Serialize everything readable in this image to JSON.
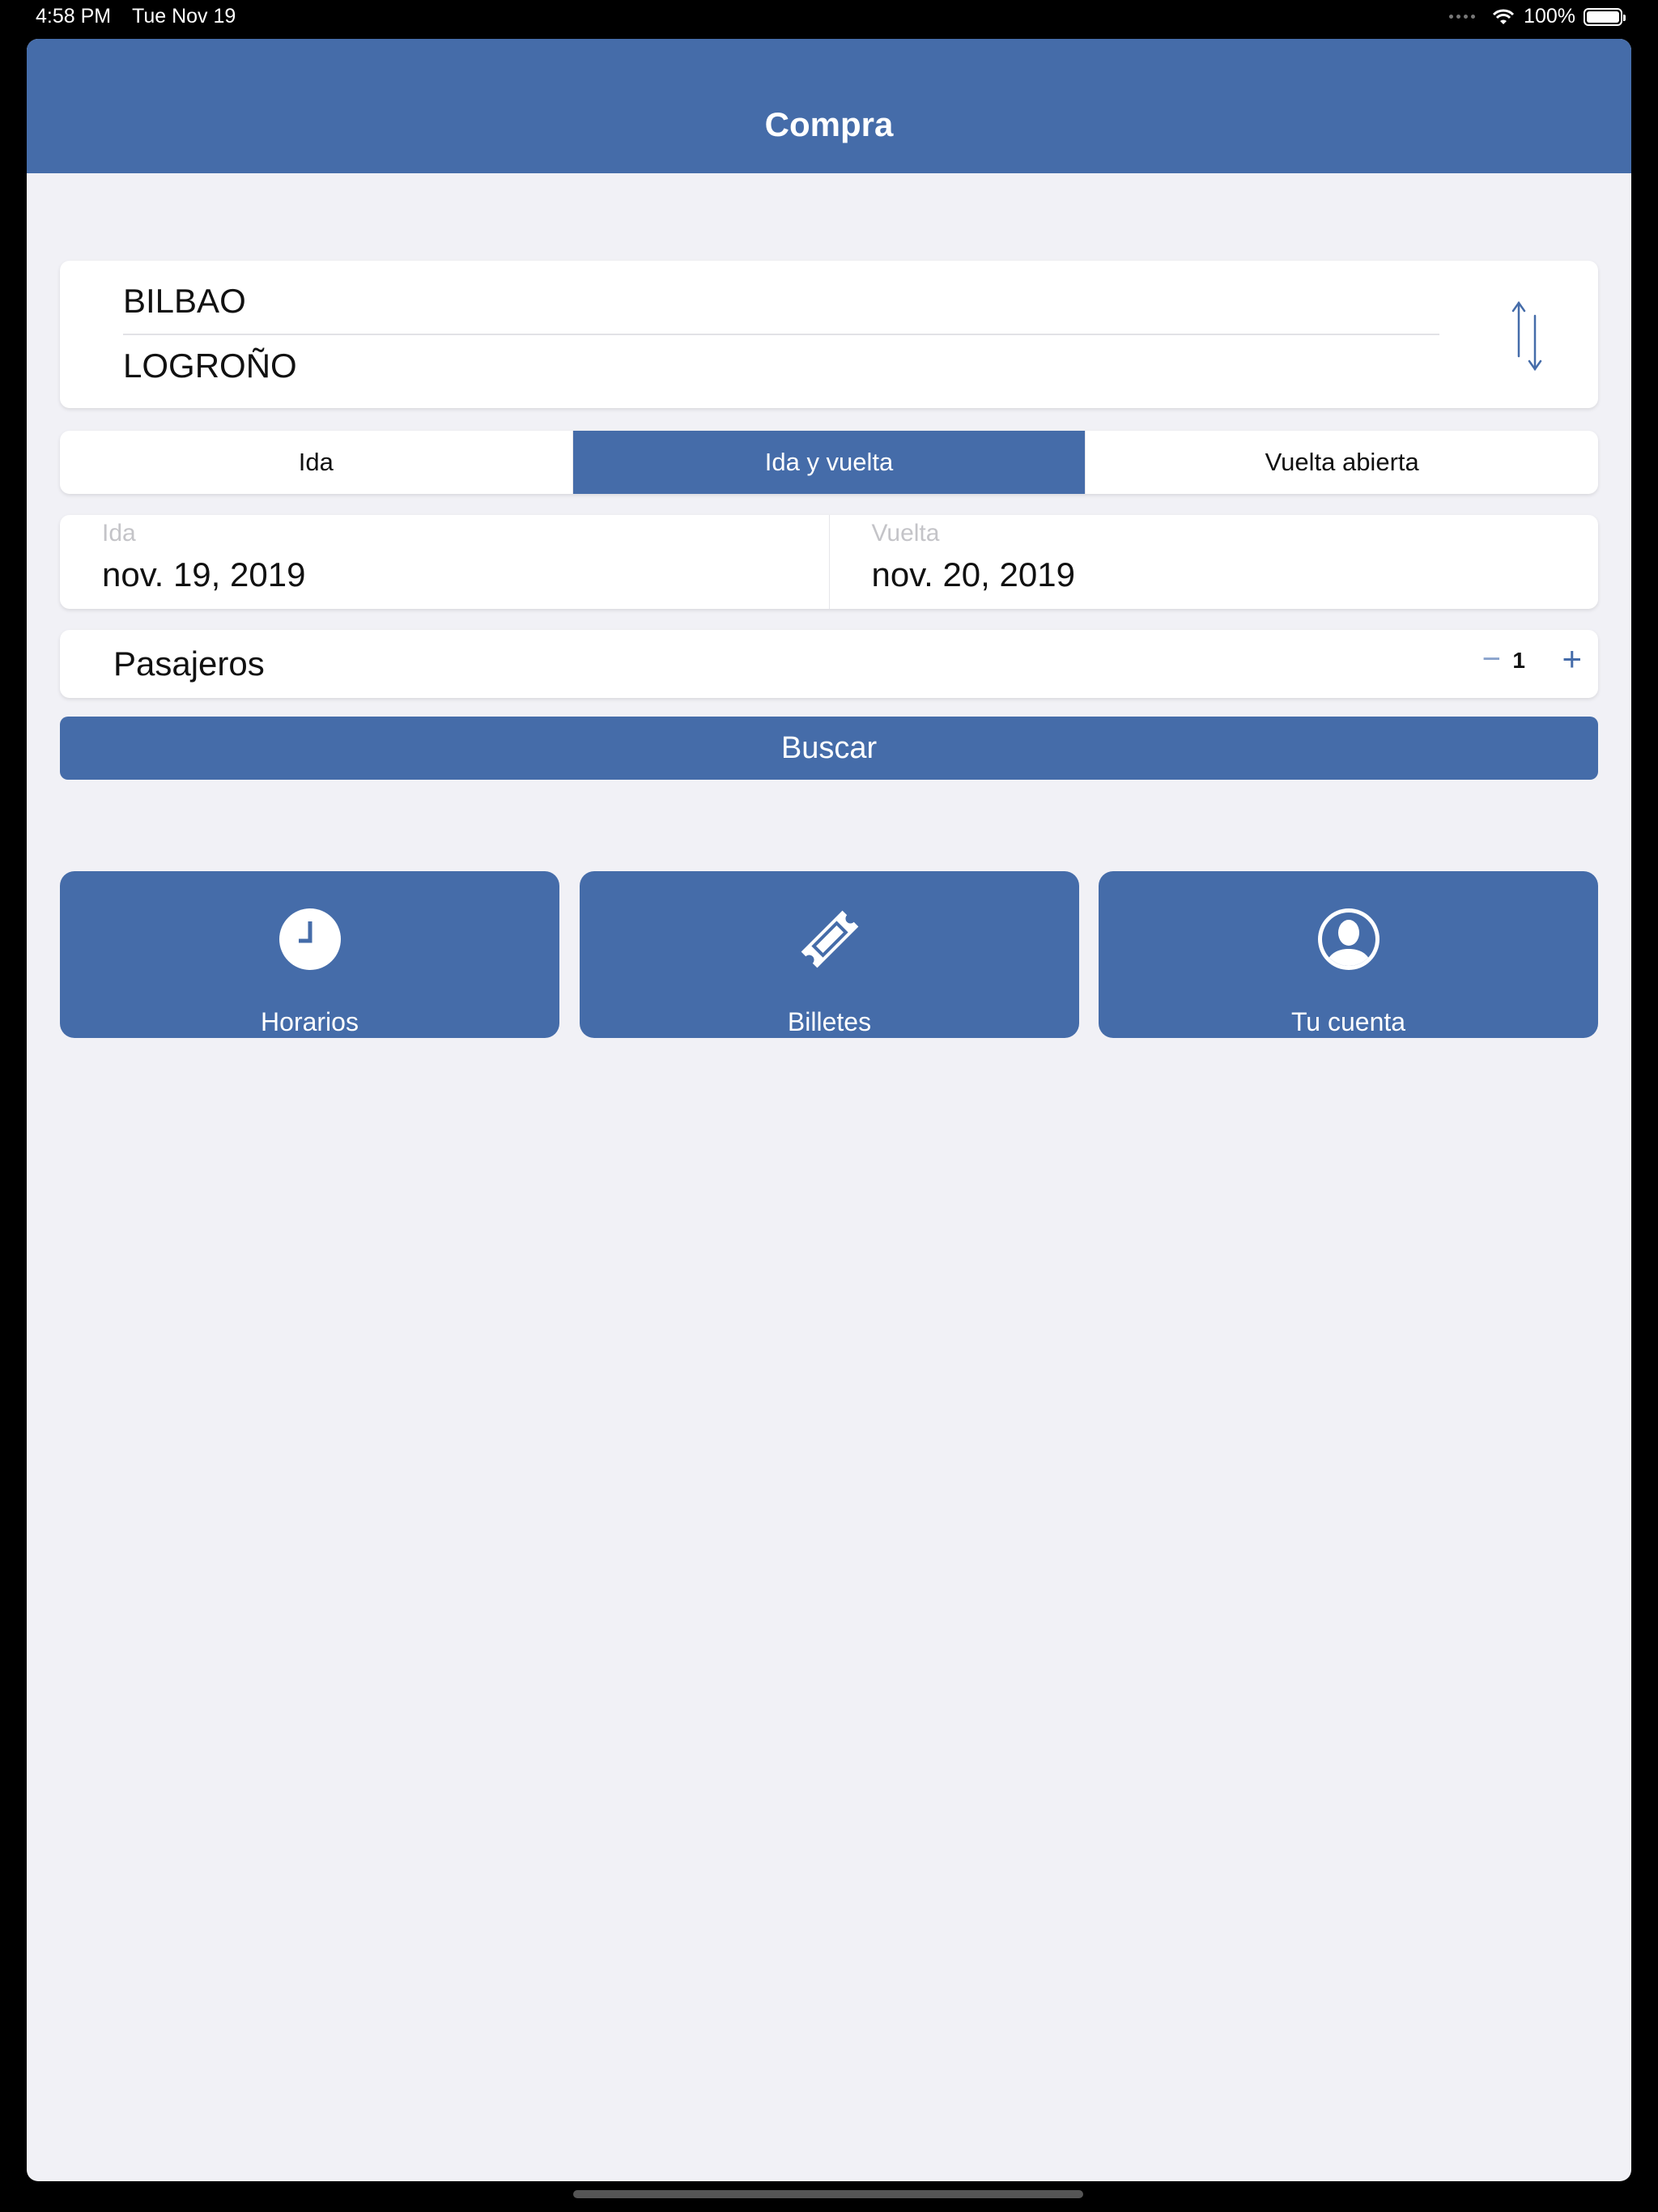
{
  "status_bar": {
    "time": "4:58 PM",
    "date": "Tue Nov 19",
    "battery": "100%"
  },
  "navbar": {
    "title": "Compra"
  },
  "route": {
    "origin": "BILBAO",
    "destination": "LOGROÑO",
    "swap_icon": "swap-vertical-arrows-icon"
  },
  "trip_type": {
    "options": [
      "Ida",
      "Ida y vuelta",
      "Vuelta abierta"
    ],
    "selected": "Ida y vuelta"
  },
  "dates": {
    "outbound_label": "Ida",
    "outbound_value": "nov. 19, 2019",
    "return_label": "Vuelta",
    "return_value": "nov. 20, 2019"
  },
  "passengers": {
    "label": "Pasajeros",
    "minus": "−",
    "count": "1",
    "plus": "+"
  },
  "search_button": {
    "label": "Buscar"
  },
  "tiles": [
    {
      "label": "Horarios",
      "icon": "clock-icon"
    },
    {
      "label": "Billetes",
      "icon": "ticket-icon"
    },
    {
      "label": "Tu cuenta",
      "icon": "user-account-icon"
    }
  ],
  "colors": {
    "accent": "#456ca9",
    "background": "#f1f1f6"
  }
}
